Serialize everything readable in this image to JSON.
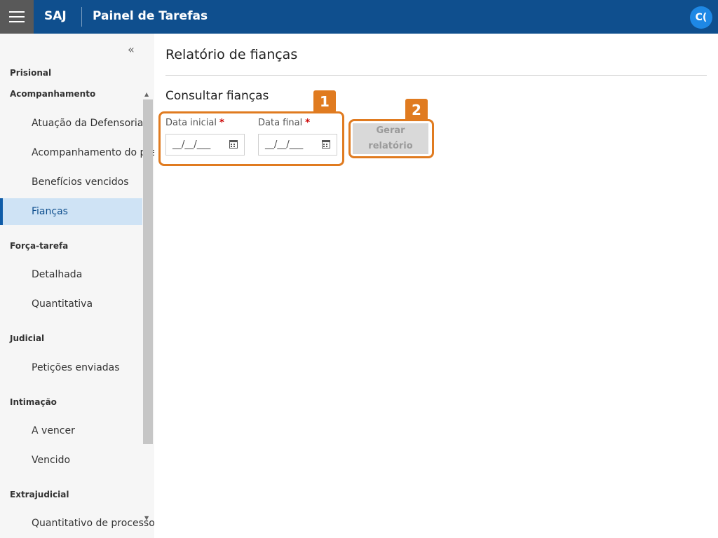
{
  "header": {
    "brand": "SAJ",
    "title": "Painel de Tarefas",
    "avatar_initials": "C(",
    "colors": {
      "bar": "#0f4f8e",
      "menu_button": "#595959",
      "avatar": "#1e88e5"
    }
  },
  "sidebar": {
    "collapse_glyph": "«",
    "sections": [
      {
        "label": "Prisional",
        "items": []
      },
      {
        "label": "Acompanhamento",
        "items": [
          "Atuação da Defensoria",
          "Acompanhamento do pre",
          "Benefícios vencidos",
          "Fianças"
        ]
      },
      {
        "label": "Força-tarefa",
        "items": [
          "Detalhada",
          "Quantitativa"
        ]
      },
      {
        "label": "Judicial",
        "items": [
          "Petições enviadas"
        ]
      },
      {
        "label": "Intimação",
        "items": [
          "A vencer",
          "Vencido"
        ]
      },
      {
        "label": "Extrajudicial",
        "items": [
          "Quantitativo de processo"
        ]
      }
    ],
    "active_item": "Fianças",
    "active_color": "#cfe3f5"
  },
  "main": {
    "page_title": "Relatório de fianças",
    "section_title": "Consultar fianças",
    "fields": {
      "start": {
        "label": "Data inicial",
        "required_mark": "*",
        "value": "__/__/___",
        "icon": "calendar-icon"
      },
      "end": {
        "label": "Data final",
        "required_mark": "*",
        "value": "__/__/___",
        "icon": "calendar-icon"
      }
    },
    "generate_button": {
      "line1": "Gerar",
      "line2": "relatório",
      "state": "disabled"
    }
  },
  "annotations": {
    "badge1": "1",
    "badge2": "2",
    "color": "#e07b20"
  }
}
